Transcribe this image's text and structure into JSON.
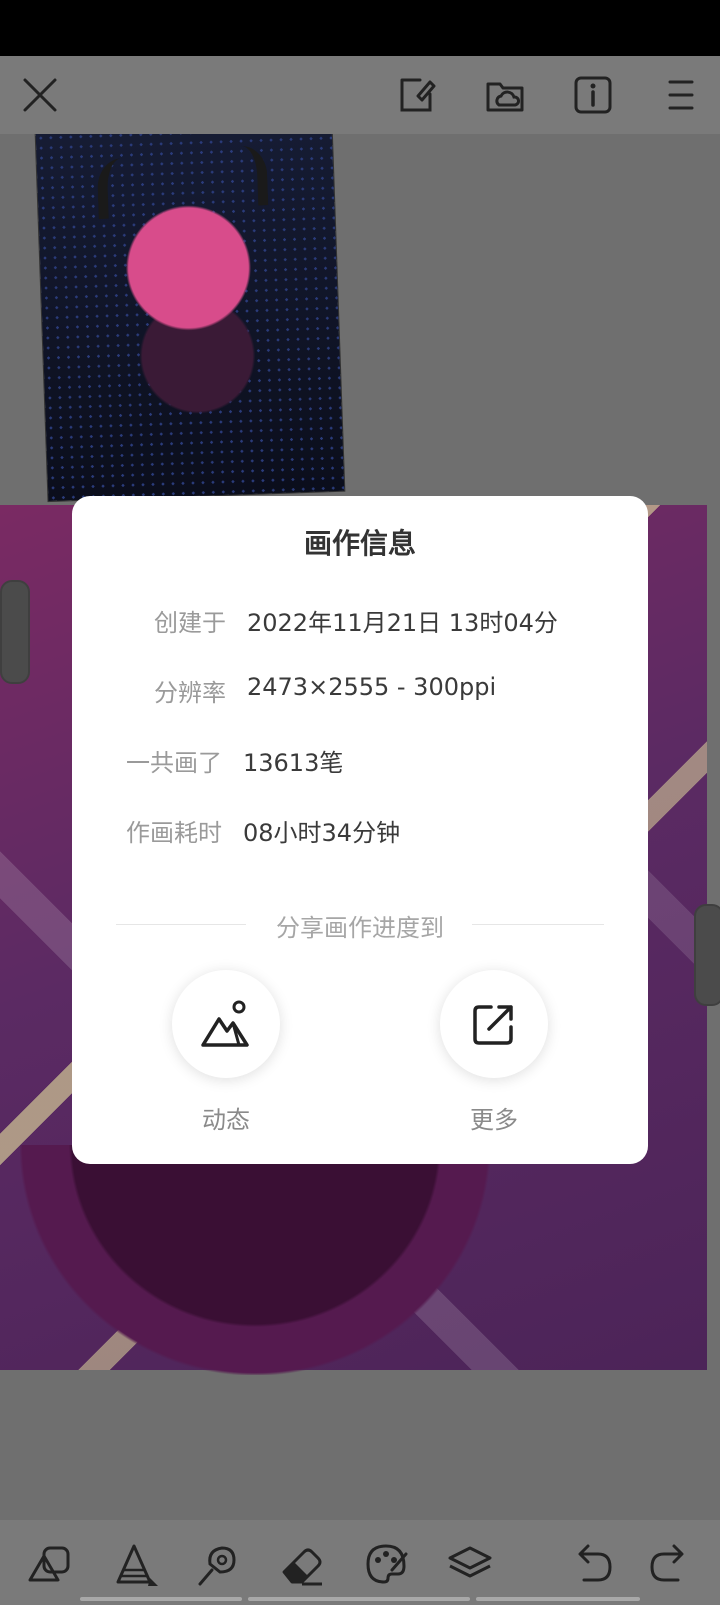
{
  "topbar": {
    "icons": [
      "close-icon",
      "document-edit-icon",
      "folder-cloud-icon",
      "info-icon",
      "menu-icon"
    ]
  },
  "dialog": {
    "title": "画作信息",
    "rows": [
      {
        "key": "创建于",
        "value": "2022年11月21日 13时04分"
      },
      {
        "key": "分辨率",
        "value": "2473×2555 - 300ppi"
      },
      {
        "key": "一共画了",
        "value": "13613笔"
      },
      {
        "key": "作画耗时",
        "value": "08小时34分钟"
      }
    ],
    "share_label": "分享画作进度到",
    "share_buttons": [
      {
        "label": "动态",
        "icon": "mountain-image-icon"
      },
      {
        "label": "更多",
        "icon": "external-share-icon"
      }
    ]
  },
  "bottombar": {
    "tools": [
      "shape-select-icon",
      "brush-icon",
      "smudge-icon",
      "eraser-icon",
      "palette-icon",
      "layers-icon",
      "undo-icon",
      "redo-icon"
    ]
  },
  "colors": {
    "overlay": "#6d6d6d",
    "dialog_bg": "#ffffff",
    "key_text": "#9a9a9a",
    "value_text": "#3a3a3a"
  }
}
